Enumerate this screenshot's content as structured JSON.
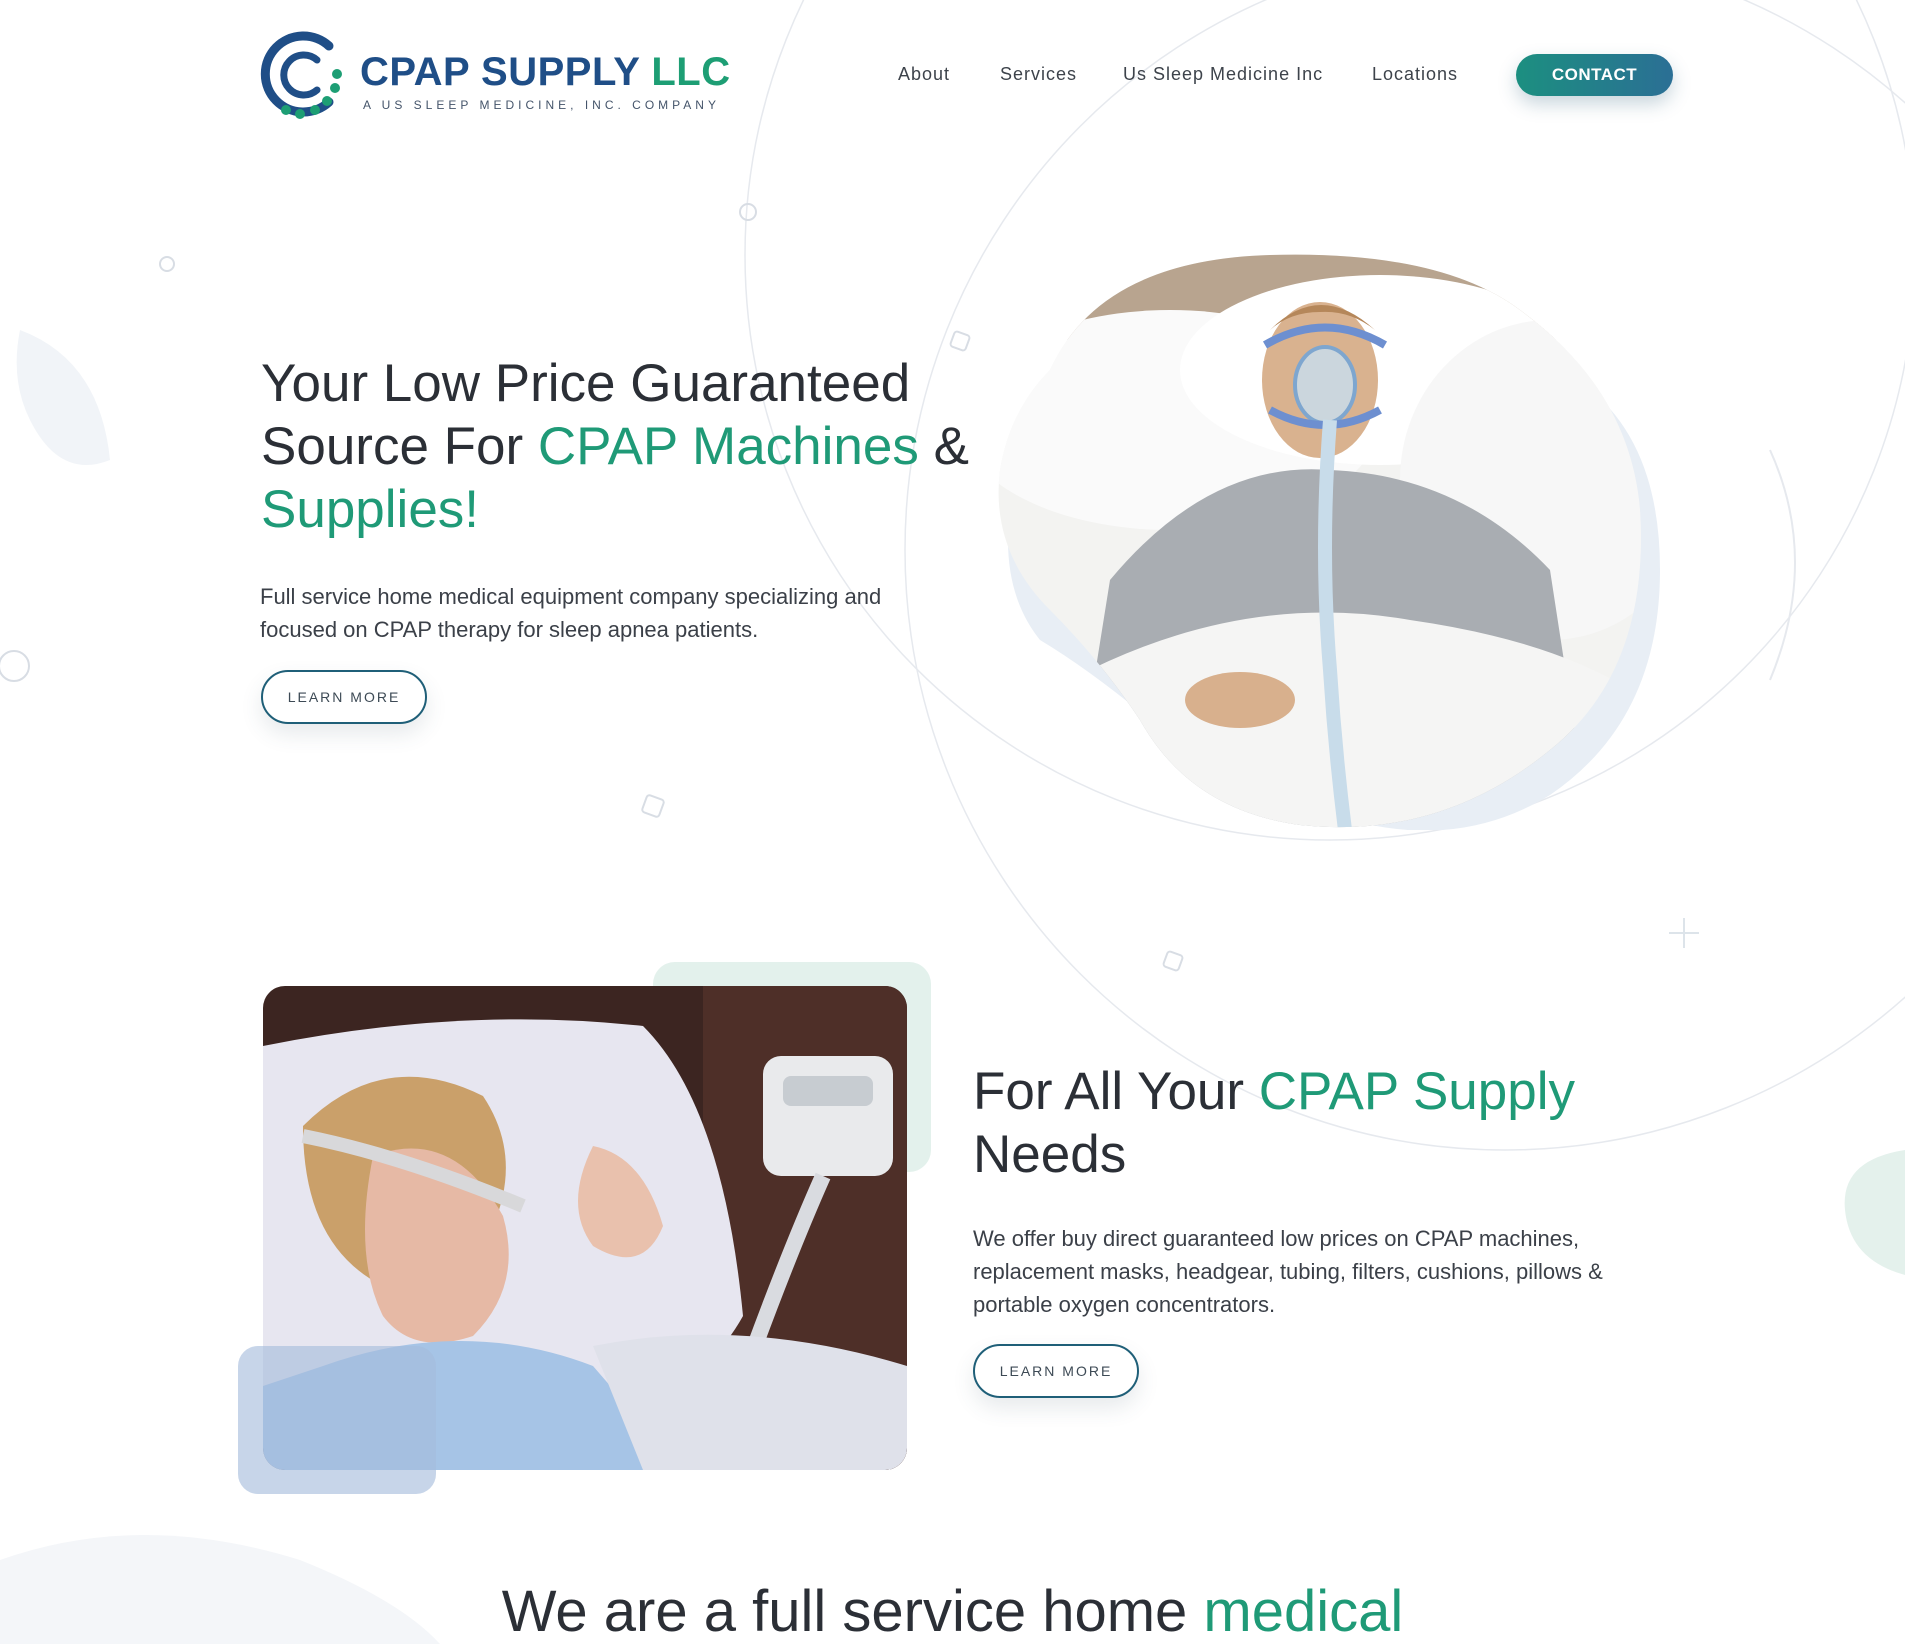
{
  "brand": {
    "name": "CPAP SUPPLY",
    "name_suffix": "LLC",
    "tagline": "A US SLEEP MEDICINE, INC. COMPANY"
  },
  "nav": {
    "items": [
      {
        "label": "About"
      },
      {
        "label": "Services"
      },
      {
        "label": "Us Sleep Medicine Inc"
      },
      {
        "label": "Locations"
      }
    ],
    "contact_label": "CONTACT"
  },
  "hero": {
    "title_part1": "Your Low Price Guaranteed Source For ",
    "title_accent1": "CPAP Machines",
    "title_part2": " & ",
    "title_accent2": "Supplies!",
    "description": "Full service home medical equipment company specializing and focused on CPAP therapy for sleep apnea patients.",
    "button_label": "LEARN MORE"
  },
  "section2": {
    "title_part1": "For All Your ",
    "title_accent": "CPAP Supply",
    "title_part2": " Needs",
    "description": "We offer buy direct guaranteed low prices on CPAP machines, replacement masks, headgear, tubing, filters, cushions, pillows & portable oxygen concentrators.",
    "button_label": "LEARN MORE"
  },
  "section3": {
    "title_part1": "We are a full service home ",
    "title_accent": "medical"
  },
  "colors": {
    "accent_green": "#1f9a77",
    "brand_blue": "#1f4e87",
    "button_gradient_start": "#1c8f80",
    "button_gradient_end": "#2b6f95"
  }
}
